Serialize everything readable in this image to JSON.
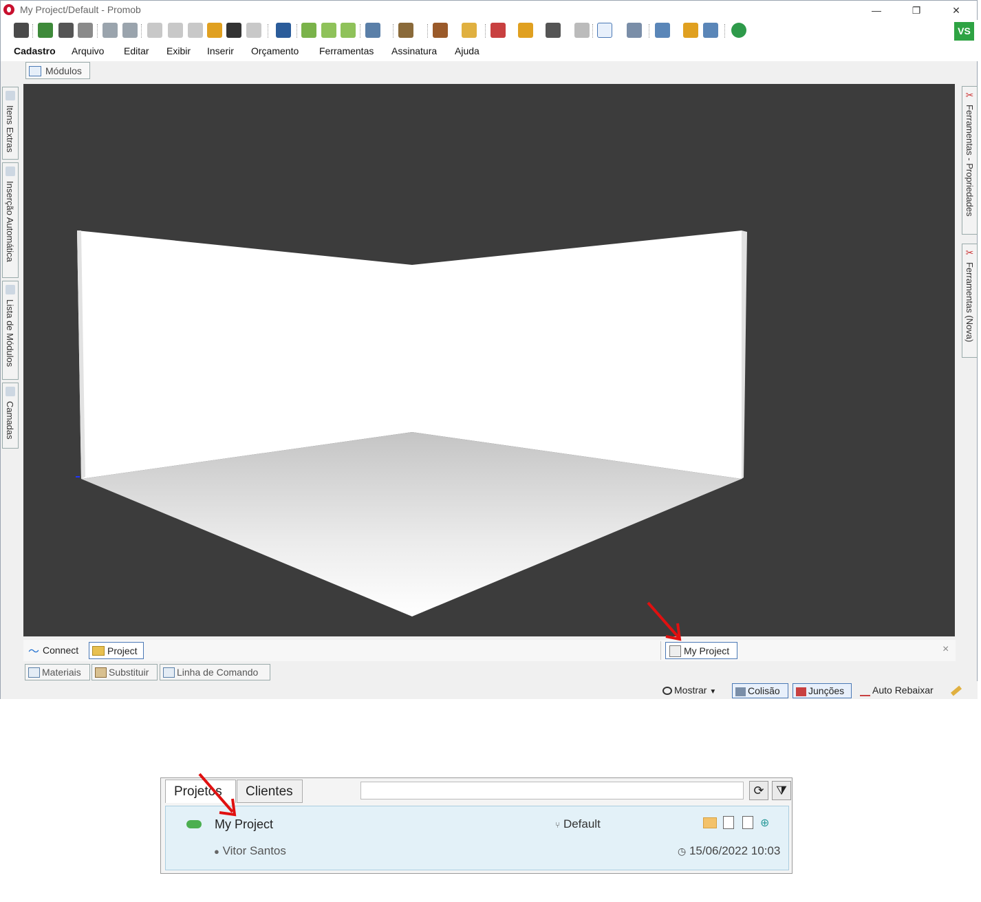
{
  "window": {
    "title": "My Project/Default - Promob",
    "minimize_glyph": "—",
    "restore_glyph": "❐",
    "close_glyph": "✕"
  },
  "toolbar": {
    "buttons": [
      "save",
      "open-library",
      "print",
      "print-preview",
      "undo",
      "redo",
      "cut",
      "copy",
      "paste",
      "paint",
      "format-brush",
      "delete",
      "view-eye",
      "insert-module",
      "move-left",
      "move-right",
      "view-cube",
      "box",
      "cabinet",
      "render",
      "explode",
      "grid",
      "snap",
      "select",
      "measure",
      "layers",
      "quota",
      "3d",
      "budget"
    ],
    "badge": "VS"
  },
  "menu": {
    "items": [
      "Cadastro",
      "Arquivo",
      "Editar",
      "Exibir",
      "Inserir",
      "Orçamento",
      "Ferramentas",
      "Assinatura",
      "Ajuda"
    ]
  },
  "modules_tab": "Módulos",
  "left_tabs": [
    "Itens Extras",
    "Inserção Automática",
    "Lista de Módulos",
    "Camadas"
  ],
  "right_tabs": [
    "Ferramentas - Propriedades",
    "Ferramentas (Nova)"
  ],
  "doc_bar": {
    "connect": "Connect",
    "project": "Project",
    "active_doc": "My Project",
    "close": "×"
  },
  "bottom_tabs": [
    "Materiais",
    "Substituir",
    "Linha de Comando"
  ],
  "status": {
    "mostrar": "Mostrar",
    "colisao": "Colisão",
    "juncoes": "Junções",
    "auto_rebaixar": "Auto Rebaixar"
  },
  "projects_panel": {
    "tab_projects": "Projetos",
    "tab_clients": "Clientes",
    "search_value": "",
    "project_name": "My Project",
    "project_env": "Default",
    "owner": "Vitor Santos",
    "date": "15/06/2022 10:03"
  },
  "colors": {
    "viewport_bg": "#3c3c3c",
    "accent_blue": "#1f6fd1",
    "vs_green": "#2ea343",
    "arrow_red": "#e01010",
    "card_bg": "#e3f1f8"
  }
}
